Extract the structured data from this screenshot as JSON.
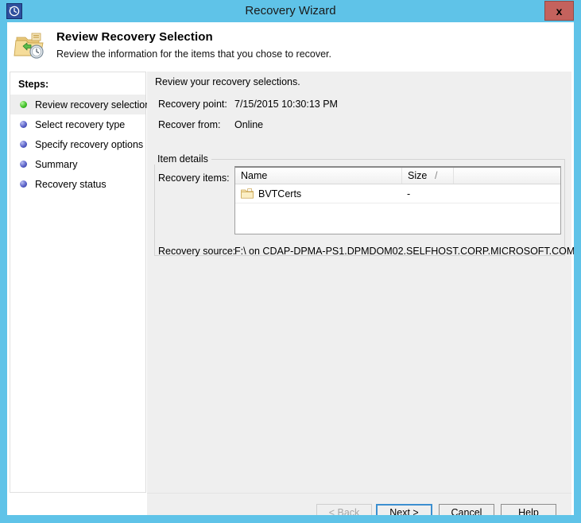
{
  "window": {
    "title": "Recovery Wizard",
    "title_icon": "recovery-clock-icon",
    "close_label": "x",
    "accent_color": "#5fc3e8",
    "close_color": "#c4625d"
  },
  "header": {
    "icon": "folder-recovery-icon",
    "title": "Review Recovery Selection",
    "subtitle": "Review the information for the items that you chose to recover."
  },
  "sidebar": {
    "label": "Steps:",
    "items": [
      {
        "label": "Review recovery selection",
        "state": "current",
        "bullet_color": "#44c22a"
      },
      {
        "label": "Select recovery type",
        "state": "pending",
        "bullet_color": "#5a62c9"
      },
      {
        "label": "Specify recovery options",
        "state": "pending",
        "bullet_color": "#5a62c9"
      },
      {
        "label": "Summary",
        "state": "pending",
        "bullet_color": "#5a62c9"
      },
      {
        "label": "Recovery status",
        "state": "pending",
        "bullet_color": "#5a62c9"
      }
    ]
  },
  "content": {
    "intro": "Review your recovery selections.",
    "fields": [
      {
        "label": "Recovery point:",
        "value": "7/15/2015 10:30:13 PM"
      },
      {
        "label": "Recover from:",
        "value": "Online"
      }
    ],
    "group": {
      "legend": "Item details",
      "recovery_items_label": "Recovery items:",
      "table": {
        "columns": [
          "Name",
          "Size",
          "/"
        ],
        "rows": [
          {
            "icon": "folder-icon",
            "name": "BVTCerts",
            "size": "-"
          }
        ]
      },
      "recovery_source_label": "Recovery source:",
      "recovery_source_value": "F:\\ on CDAP-DPMA-PS1.DPMDOM02.SELFHOST.CORP.MICROSOFT.COM"
    }
  },
  "buttons": {
    "back": "< Back",
    "next": "Next >",
    "cancel": "Cancel",
    "help": "Help"
  }
}
